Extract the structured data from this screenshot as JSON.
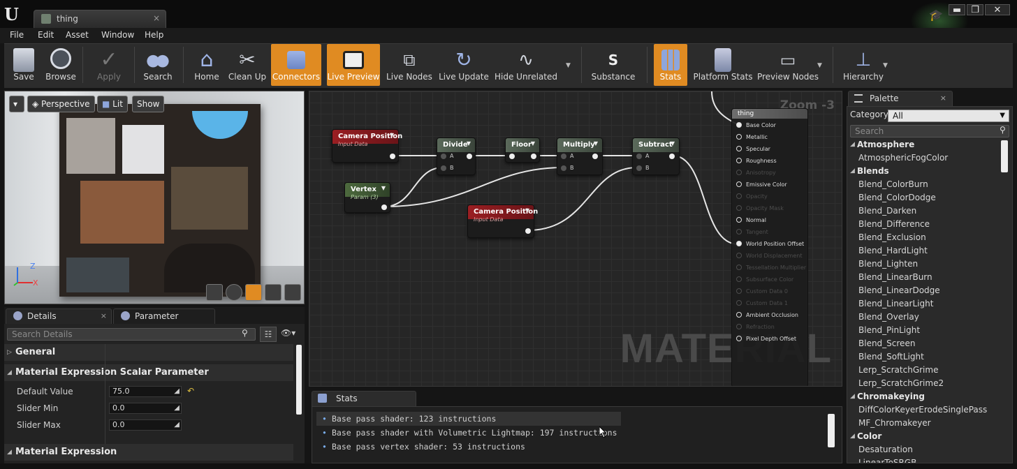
{
  "window": {
    "tab_title": "thing",
    "tab_close": "×",
    "controls": {
      "minimize": "▬",
      "restore": "❐",
      "close": "✕"
    }
  },
  "menu": [
    "File",
    "Edit",
    "Asset",
    "Window",
    "Help"
  ],
  "toolbar": {
    "save": "Save",
    "browse": "Browse",
    "apply": "Apply",
    "search": "Search",
    "home": "Home",
    "clean_up": "Clean Up",
    "connectors": "Connectors",
    "live_preview": "Live Preview",
    "live_nodes": "Live Nodes",
    "live_update": "Live Update",
    "hide_unrelated": "Hide Unrelated",
    "substance": "Substance",
    "stats": "Stats",
    "platform_stats": "Platform Stats",
    "preview_nodes": "Preview Nodes",
    "hierarchy": "Hierarchy",
    "accent": "#e08b22"
  },
  "viewport": {
    "perspective": "Perspective",
    "lit": "Lit",
    "show": "Show",
    "axis_z": "Z",
    "axis_x": "X"
  },
  "details": {
    "tab_details": "Details",
    "tab_params": "Parameter Defaults",
    "search_placeholder": "Search Details",
    "cat_general": "General",
    "cat_scalar": "Material Expression Scalar Parameter",
    "cat_expr": "Material Expression",
    "props": [
      {
        "label": "Default Value",
        "value": "75.0"
      },
      {
        "label": "Slider Min",
        "value": "0.0"
      },
      {
        "label": "Slider Max",
        "value": "0.0"
      }
    ]
  },
  "graph": {
    "zoom": "Zoom -3",
    "watermark": "MATERIAL",
    "nodes": {
      "camera1": {
        "title": "Camera Position",
        "sub": "Input Data"
      },
      "vertex": {
        "title": "Vertex",
        "sub": "Param (3)"
      },
      "camera2": {
        "title": "Camera Position",
        "sub": "Input Data"
      },
      "divide": {
        "title": "Divide"
      },
      "floor": {
        "title": "Floor"
      },
      "multiply": {
        "title": "Multiply"
      },
      "subtract": {
        "title": "Subtract"
      },
      "pin_a": "A",
      "pin_b": "B"
    },
    "result": {
      "title": "thing",
      "inputs": [
        {
          "label": "Base Color",
          "state": "full"
        },
        {
          "label": "Metallic",
          "state": "on"
        },
        {
          "label": "Specular",
          "state": "on"
        },
        {
          "label": "Roughness",
          "state": "on"
        },
        {
          "label": "Anisotropy",
          "state": "dim"
        },
        {
          "label": "Emissive Color",
          "state": "on"
        },
        {
          "label": "Opacity",
          "state": "dim"
        },
        {
          "label": "Opacity Mask",
          "state": "dim"
        },
        {
          "label": "Normal",
          "state": "on"
        },
        {
          "label": "Tangent",
          "state": "dim"
        },
        {
          "label": "World Position Offset",
          "state": "full"
        },
        {
          "label": "World Displacement",
          "state": "dim"
        },
        {
          "label": "Tessellation Multiplier",
          "state": "dim"
        },
        {
          "label": "Subsurface Color",
          "state": "dim"
        },
        {
          "label": "Custom Data 0",
          "state": "dim"
        },
        {
          "label": "Custom Data 1",
          "state": "dim"
        },
        {
          "label": "Ambient Occlusion",
          "state": "on"
        },
        {
          "label": "Refraction",
          "state": "dim"
        },
        {
          "label": "Pixel Depth Offset",
          "state": "on"
        }
      ]
    }
  },
  "stats": {
    "tab": "Stats",
    "lines": [
      "Base pass shader: 123 instructions",
      "Base pass shader with Volumetric Lightmap: 197 instructions",
      "Base pass vertex shader: 53 instructions"
    ]
  },
  "palette": {
    "tab": "Palette",
    "category_label": "Category:",
    "category_value": "All",
    "search_placeholder": "Search",
    "rows": [
      {
        "t": "h",
        "label": "Atmosphere"
      },
      {
        "t": "i",
        "label": "AtmosphericFogColor"
      },
      {
        "t": "h",
        "label": "Blends"
      },
      {
        "t": "i",
        "label": "Blend_ColorBurn"
      },
      {
        "t": "i",
        "label": "Blend_ColorDodge"
      },
      {
        "t": "i",
        "label": "Blend_Darken"
      },
      {
        "t": "i",
        "label": "Blend_Difference"
      },
      {
        "t": "i",
        "label": "Blend_Exclusion"
      },
      {
        "t": "i",
        "label": "Blend_HardLight"
      },
      {
        "t": "i",
        "label": "Blend_Lighten"
      },
      {
        "t": "i",
        "label": "Blend_LinearBurn"
      },
      {
        "t": "i",
        "label": "Blend_LinearDodge"
      },
      {
        "t": "i",
        "label": "Blend_LinearLight"
      },
      {
        "t": "i",
        "label": "Blend_Overlay"
      },
      {
        "t": "i",
        "label": "Blend_PinLight"
      },
      {
        "t": "i",
        "label": "Blend_Screen"
      },
      {
        "t": "i",
        "label": "Blend_SoftLight"
      },
      {
        "t": "i",
        "label": "Lerp_ScratchGrime"
      },
      {
        "t": "i",
        "label": "Lerp_ScratchGrime2"
      },
      {
        "t": "h",
        "label": "Chromakeying"
      },
      {
        "t": "i",
        "label": "DiffColorKeyerErodeSinglePass"
      },
      {
        "t": "i",
        "label": "MF_Chromakeyer"
      },
      {
        "t": "h",
        "label": "Color"
      },
      {
        "t": "i",
        "label": "Desaturation"
      },
      {
        "t": "i",
        "label": "LinearToSRGB"
      }
    ]
  }
}
